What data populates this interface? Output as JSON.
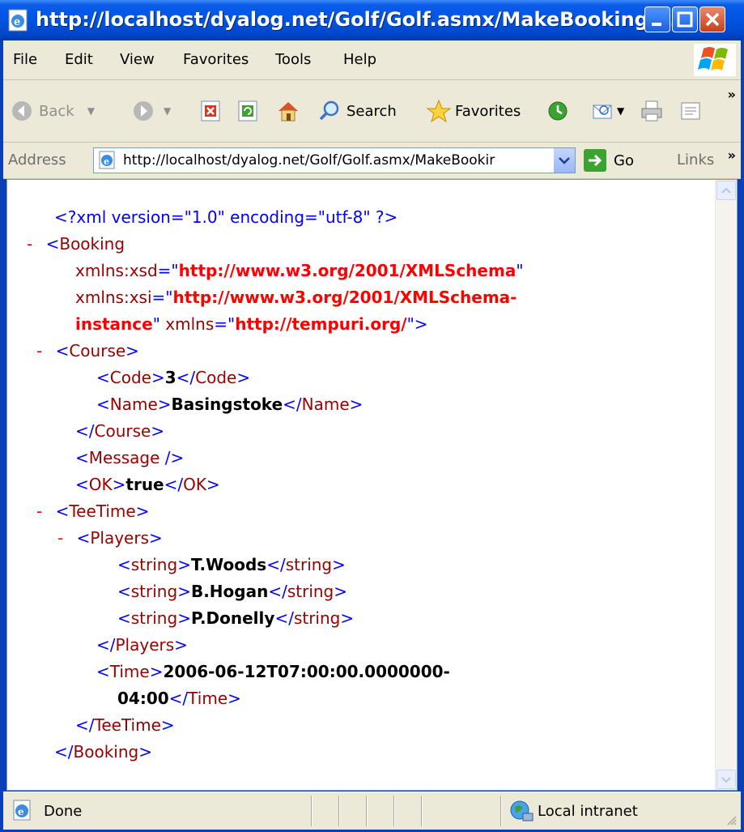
{
  "window": {
    "title": "http://localhost/dyalog.net/Golf/Golf.asmx/MakeBooking ..."
  },
  "menu": {
    "items": [
      "File",
      "Edit",
      "View",
      "Favorites",
      "Tools",
      "Help"
    ]
  },
  "toolbar": {
    "back_label": "Back",
    "search_label": "Search",
    "favorites_label": "Favorites"
  },
  "address": {
    "label": "Address",
    "value": "http://localhost/dyalog.net/Golf/Golf.asmx/MakeBookir",
    "go_label": "Go",
    "links_label": "Links"
  },
  "xml": {
    "declaration": "<?xml version=\"1.0\" encoding=\"utf-8\" ?>",
    "collapse_symbol": "-",
    "booking_open": "Booking",
    "xsd_attr": "xmlns:xsd",
    "xsd_val": "http://www.w3.org/2001/XMLSchema",
    "xsi_attr": "xmlns:xsi",
    "xsi_val_1": "http://www.w3.org/2001/XMLSchema-",
    "xsi_val_2": "instance",
    "xmlns_attr": "xmlns",
    "xmlns_val": "http://tempuri.org/",
    "course_tag": "Course",
    "code_tag": "Code",
    "code_val": "3",
    "name_tag": "Name",
    "name_val": "Basingstoke",
    "message_tag": "Message",
    "ok_tag": "OK",
    "ok_val": "true",
    "teetime_tag": "TeeTime",
    "players_tag": "Players",
    "string_tag": "string",
    "players": [
      "T.Woods",
      "B.Hogan",
      "P.Donelly"
    ],
    "time_tag": "Time",
    "time_val_1": "2006-06-12T07:00:00.0000000-",
    "time_val_2": "04:00",
    "booking_close": "Booking"
  },
  "status": {
    "text": "Done",
    "zone": "Local intranet"
  }
}
